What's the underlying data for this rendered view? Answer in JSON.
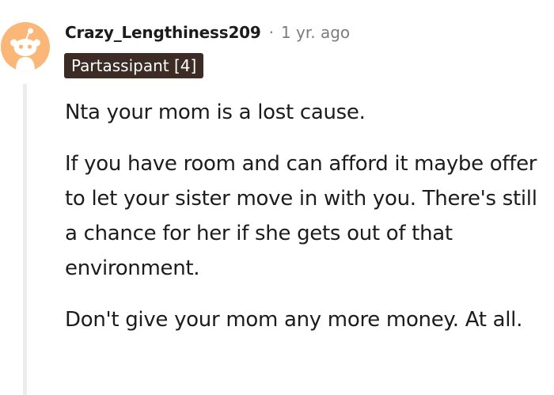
{
  "comment": {
    "username": "Crazy_Lengthiness209",
    "separator": "·",
    "timestamp": "1 yr. ago",
    "flair": "Partassipant [4]",
    "paragraphs": [
      "Nta your mom is a lost cause.",
      "If you have room and can afford it maybe offer to let your sister move in with you. There's still a chance for her if she gets out of that environment.",
      "Don't give your mom any more money. At all."
    ],
    "avatar_icon": "snoo-avatar-icon",
    "colors": {
      "avatar_bg": "#fbb777",
      "flair_bg": "#3d2c25",
      "flair_text": "#ffffff",
      "meta_text": "#7c7c7c",
      "body_text": "#1c1c1c",
      "thread_line": "#ececec"
    }
  }
}
